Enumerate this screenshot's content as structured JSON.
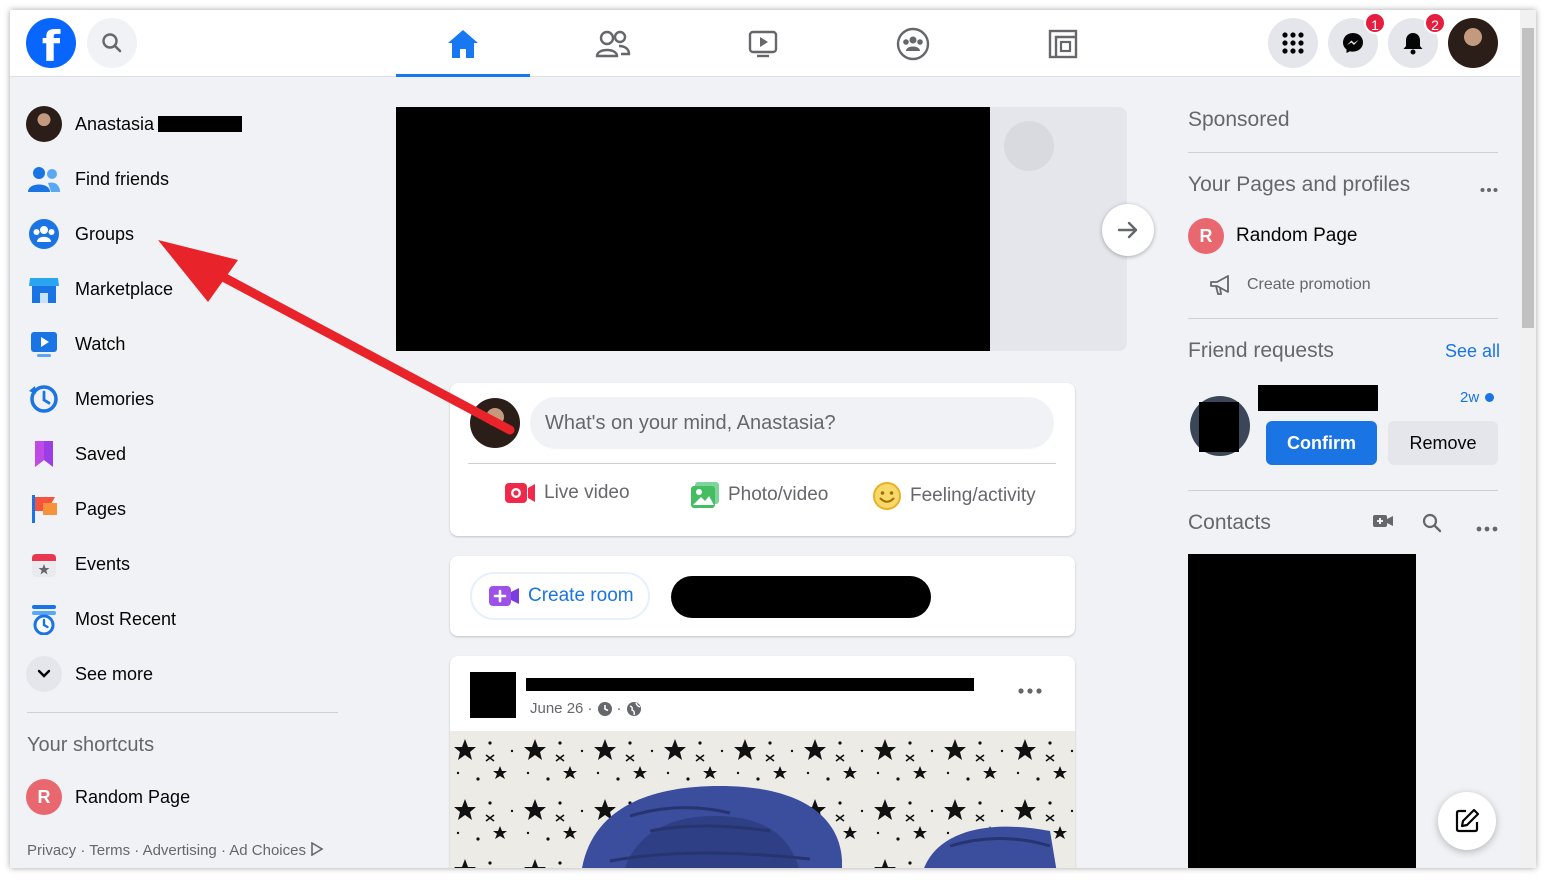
{
  "topbar": {
    "logo_letter": "f",
    "nav_tabs": [
      "home",
      "friends",
      "watch",
      "groups",
      "gaming"
    ],
    "messenger_badge": "1",
    "notifications_badge": "2"
  },
  "sidebar": {
    "user_name": "Anastasia",
    "items": [
      {
        "label": "Find friends",
        "icon": "friends-icon"
      },
      {
        "label": "Groups",
        "icon": "groups-icon"
      },
      {
        "label": "Marketplace",
        "icon": "marketplace-icon"
      },
      {
        "label": "Watch",
        "icon": "watch-icon"
      },
      {
        "label": "Memories",
        "icon": "memories-icon"
      },
      {
        "label": "Saved",
        "icon": "saved-icon"
      },
      {
        "label": "Pages",
        "icon": "pages-icon"
      },
      {
        "label": "Events",
        "icon": "events-icon"
      },
      {
        "label": "Most Recent",
        "icon": "most-recent-icon"
      }
    ],
    "see_more": "See more",
    "shortcuts_title": "Your shortcuts",
    "shortcut_page_initial": "R",
    "shortcut_page": "Random Page",
    "footer": "Privacy · Terms · Advertising · Ad Choices"
  },
  "feed": {
    "composer_placeholder": "What's on your mind, Anastasia?",
    "actions": {
      "live": "Live video",
      "photo": "Photo/video",
      "feeling": "Feeling/activity"
    },
    "create_room": "Create room",
    "post_date": "June 26 ·"
  },
  "right": {
    "sponsored": "Sponsored",
    "pages_title": "Your Pages and profiles",
    "page_initial": "R",
    "page_name": "Random Page",
    "create_promotion": "Create promotion",
    "friend_requests": "Friend requests",
    "see_all": "See all",
    "request_time": "2w",
    "confirm": "Confirm",
    "remove": "Remove",
    "contacts": "Contacts"
  },
  "colors": {
    "brand": "#1877f2",
    "annotation_arrow": "#e8232a",
    "badge": "#e41e3f"
  }
}
